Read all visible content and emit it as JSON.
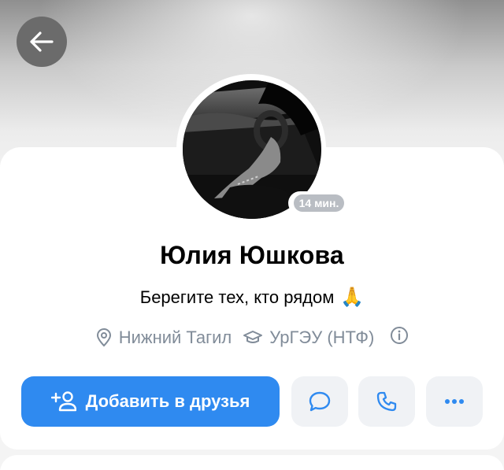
{
  "profile": {
    "name": "Юлия Юшкова",
    "status_text": "Берегите тех, кто рядом",
    "status_emoji": "🙏",
    "last_seen": "14 мин.",
    "city": "Нижний Тагил",
    "university": "УрГЭУ (НТФ)"
  },
  "actions": {
    "add_friend_label": "Добавить в друзья"
  },
  "icons": {
    "back": "arrow-left-icon",
    "location": "map-pin-icon",
    "education": "graduation-cap-icon",
    "info": "info-icon",
    "add_friend": "add-user-icon",
    "message": "message-bubble-icon",
    "call": "phone-icon",
    "more": "more-dots-icon"
  },
  "colors": {
    "accent": "#2f8af0",
    "secondary_text": "#818c99",
    "secondary_button_bg": "#f0f2f5",
    "online_badge": "#b9bdc3"
  }
}
